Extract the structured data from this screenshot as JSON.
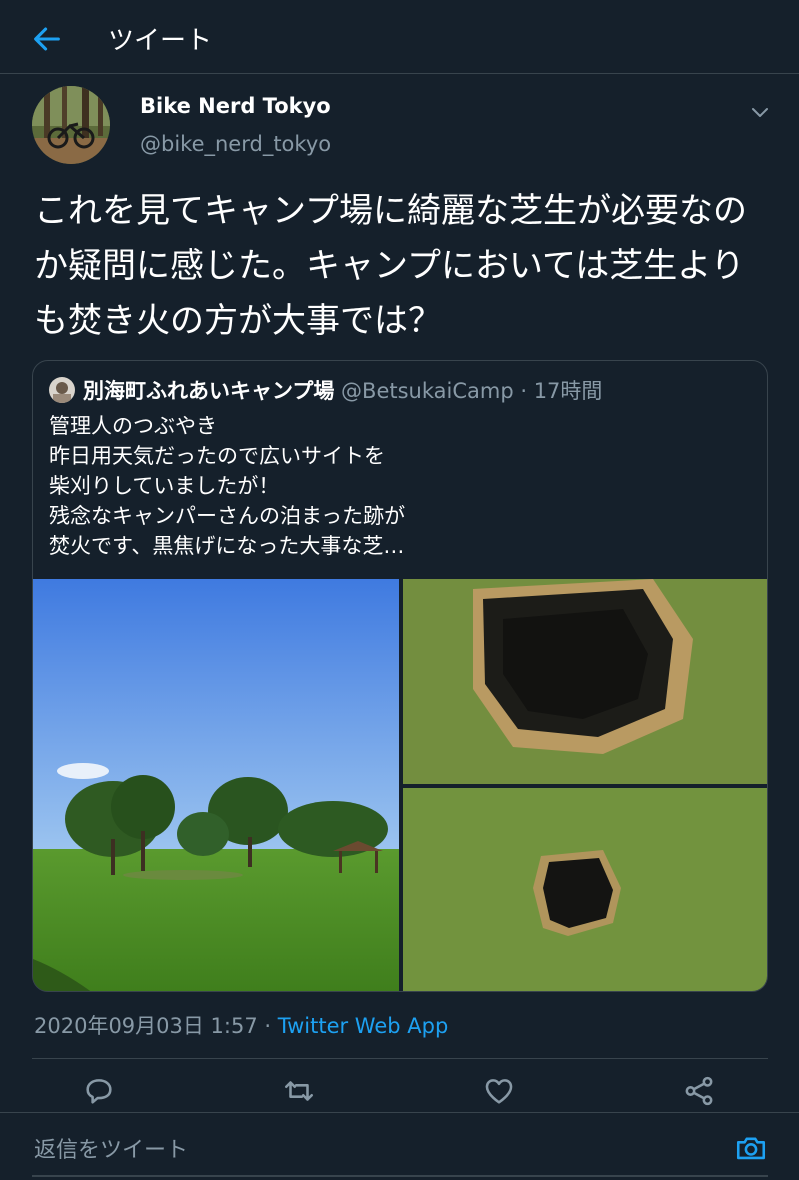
{
  "header": {
    "title": "ツイート"
  },
  "tweet": {
    "display_name": "Bike Nerd Tokyo",
    "handle": "@bike_nerd_tokyo",
    "text": "これを見てキャンプ場に綺麗な芝生が必要なのか疑問に感じた。キャンプにおいては芝生よりも焚き火の方が大事では？",
    "timestamp": "2020年09月03日 1:57 · ",
    "client": "Twitter Web App"
  },
  "quote": {
    "name": "別海町ふれあいキャンプ場",
    "handle_time": " @BetsukaiCamp · 17時間",
    "text": "管理人のつぶやき\n昨日用天気だったので広いサイトを\n柴刈りしていましたが！\n残念なキャンパーさんの泊まった跡が\n焚火です、黒焦げになった大事な芝…"
  },
  "actions": {
    "reply_icon": "reply-icon",
    "retweet_icon": "retweet-icon",
    "like_icon": "like-icon",
    "share_icon": "share-icon"
  },
  "reply_bar": {
    "placeholder": "返信をツイート"
  },
  "colors": {
    "background": "#15202b",
    "secondary_text": "#8899a6",
    "accent": "#1da1f2",
    "divider": "#38444d"
  }
}
